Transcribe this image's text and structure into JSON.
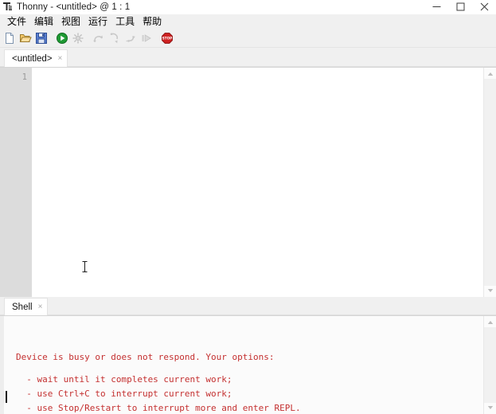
{
  "window": {
    "title": "Thonny  -  <untitled>  @  1 : 1",
    "icon": "thonny-logo-icon",
    "controls": {
      "minimize": "minimize-icon",
      "maximize": "maximize-icon",
      "close": "close-icon"
    }
  },
  "menubar": {
    "items": [
      {
        "label": "文件",
        "name": "menu-file"
      },
      {
        "label": "编辑",
        "name": "menu-edit"
      },
      {
        "label": "视图",
        "name": "menu-view"
      },
      {
        "label": "运行",
        "name": "menu-run"
      },
      {
        "label": "工具",
        "name": "menu-tools"
      },
      {
        "label": "帮助",
        "name": "menu-help"
      }
    ]
  },
  "toolbar": {
    "buttons": [
      {
        "icon": "new-file-icon",
        "enabled": true
      },
      {
        "icon": "open-file-icon",
        "enabled": true
      },
      {
        "icon": "save-file-icon",
        "enabled": true
      },
      {
        "icon": "run-icon",
        "enabled": true
      },
      {
        "icon": "debug-icon",
        "enabled": false
      },
      {
        "icon": "step-over-icon",
        "enabled": false
      },
      {
        "icon": "step-into-icon",
        "enabled": false
      },
      {
        "icon": "step-out-icon",
        "enabled": false
      },
      {
        "icon": "resume-icon",
        "enabled": false
      },
      {
        "icon": "stop-icon",
        "enabled": true
      }
    ]
  },
  "editor": {
    "tab": {
      "label": "<untitled>",
      "close": "×"
    },
    "line_numbers": [
      "1"
    ],
    "content": "",
    "cursor_position": "1 : 1"
  },
  "shell": {
    "tab": {
      "label": "Shell",
      "close": "×"
    },
    "text_color": "#c43030",
    "lines": [
      "Device is busy or does not respond. Your options:",
      "",
      "  - wait until it completes current work;",
      "  - use Ctrl+C to interrupt current work;",
      "  - use Stop/Restart to interrupt more and enter REPL."
    ]
  },
  "colors": {
    "chrome": "#f0f0f0",
    "editor_bg": "#ffffff",
    "gutter_bg": "#dcdcdc",
    "shell_bg": "#fbfbfb",
    "error_red": "#c43030",
    "accent_green": "#1f9a34"
  }
}
